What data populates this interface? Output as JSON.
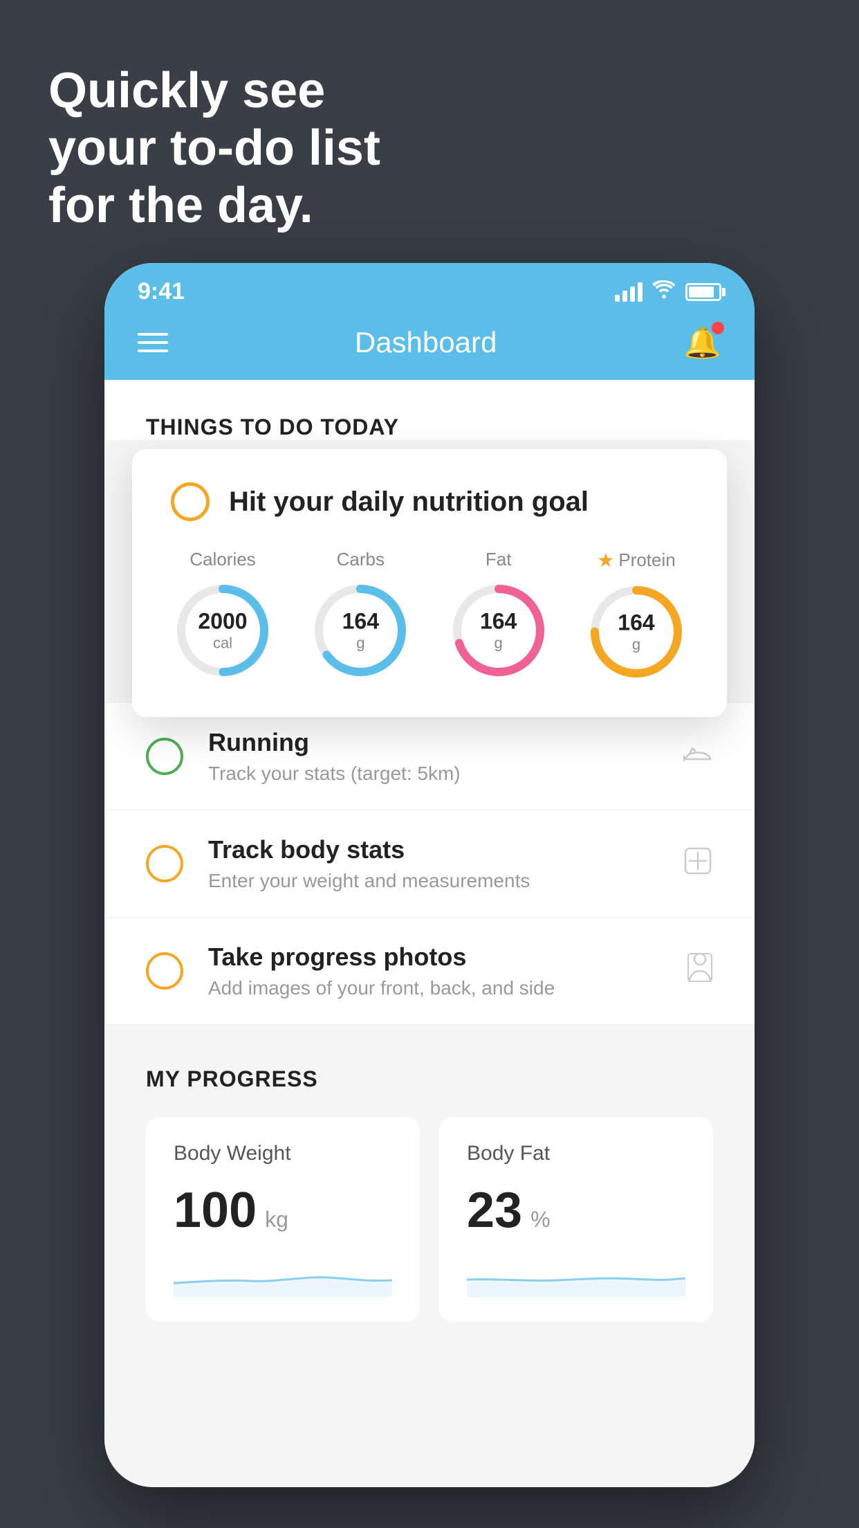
{
  "background": {
    "color": "#3a3f47"
  },
  "headline": {
    "line1": "Quickly see",
    "line2": "your to-do list",
    "line3": "for the day."
  },
  "status_bar": {
    "time": "9:41",
    "signal": "full",
    "wifi": true,
    "battery": 85
  },
  "header": {
    "title": "Dashboard"
  },
  "things_section": {
    "title": "THINGS TO DO TODAY"
  },
  "nutrition_card": {
    "check_label": "circle-check",
    "title": "Hit your daily nutrition goal",
    "items": [
      {
        "label": "Calories",
        "value": "2000",
        "unit": "cal",
        "color": "#5bbee8",
        "percent": 55
      },
      {
        "label": "Carbs",
        "value": "164",
        "unit": "g",
        "color": "#5bbee8",
        "percent": 65
      },
      {
        "label": "Fat",
        "value": "164",
        "unit": "g",
        "color": "#f06292",
        "percent": 70
      },
      {
        "label": "Protein",
        "value": "164",
        "unit": "g",
        "color": "#f5a623",
        "percent": 75,
        "star": true
      }
    ]
  },
  "todo_items": [
    {
      "title": "Running",
      "subtitle": "Track your stats (target: 5km)",
      "circle_color": "green",
      "icon": "shoe"
    },
    {
      "title": "Track body stats",
      "subtitle": "Enter your weight and measurements",
      "circle_color": "yellow",
      "icon": "scale"
    },
    {
      "title": "Take progress photos",
      "subtitle": "Add images of your front, back, and side",
      "circle_color": "yellow",
      "icon": "person"
    }
  ],
  "progress_section": {
    "title": "MY PROGRESS",
    "cards": [
      {
        "title": "Body Weight",
        "value": "100",
        "unit": "kg"
      },
      {
        "title": "Body Fat",
        "value": "23",
        "unit": "%"
      }
    ]
  }
}
